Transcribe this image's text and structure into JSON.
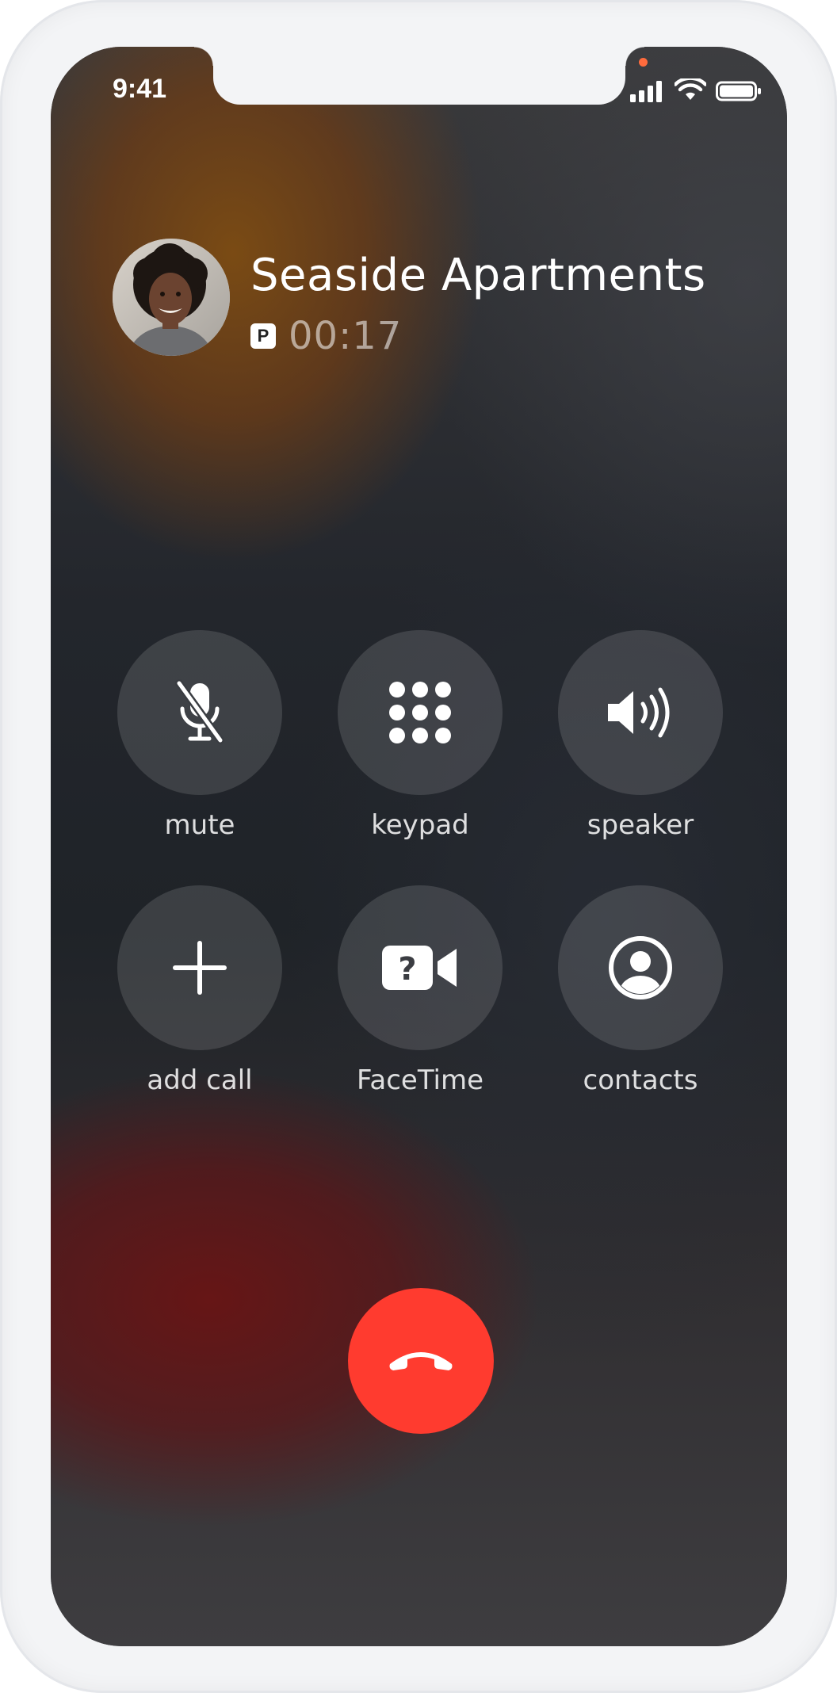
{
  "status_bar": {
    "time": "9:41",
    "icons": [
      "signal-icon",
      "wifi-icon",
      "battery-icon"
    ]
  },
  "caller": {
    "name": "Seaside Apartments",
    "badge": "P",
    "duration": "00:17",
    "avatar": "avatar"
  },
  "controls": [
    {
      "label": "mute",
      "icon": "mic-off-icon"
    },
    {
      "label": "keypad",
      "icon": "keypad-icon"
    },
    {
      "label": "speaker",
      "icon": "speaker-icon"
    },
    {
      "label": "add call",
      "icon": "plus-icon"
    },
    {
      "label": "FaceTime",
      "icon": "facetime-icon"
    },
    {
      "label": "contacts",
      "icon": "contact-icon"
    }
  ],
  "end_call": {
    "icon": "end-call-icon",
    "color": "#ff3b2f"
  },
  "colors": {
    "status_dot": "#ff6b3d",
    "end_call": "#ff3b2f"
  }
}
